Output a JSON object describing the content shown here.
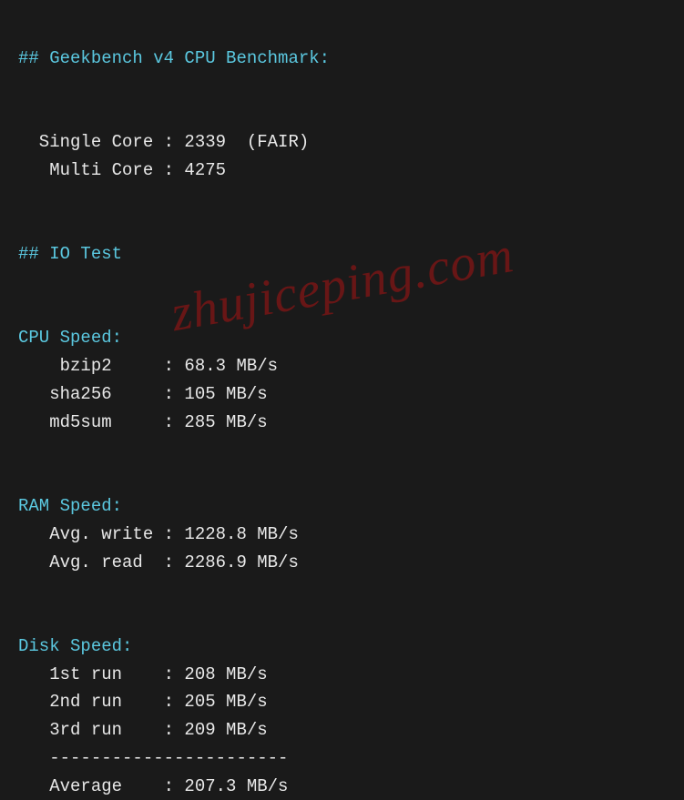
{
  "section1": {
    "heading": "## Geekbench v4 CPU Benchmark:",
    "lines": [
      "  Single Core : 2339  (FAIR)",
      "   Multi Core : 4275"
    ]
  },
  "section2": {
    "heading": "## IO Test"
  },
  "cpuSpeed": {
    "heading": "CPU Speed:",
    "lines": [
      "    bzip2     : 68.3 MB/s",
      "   sha256     : 105 MB/s",
      "   md5sum     : 285 MB/s"
    ]
  },
  "ramSpeed": {
    "heading": "RAM Speed:",
    "lines": [
      "   Avg. write : 1228.8 MB/s",
      "   Avg. read  : 2286.9 MB/s"
    ]
  },
  "diskSpeed": {
    "heading": "Disk Speed:",
    "lines": [
      "   1st run    : 208 MB/s",
      "   2nd run    : 205 MB/s",
      "   3rd run    : 209 MB/s",
      "   -----------------------",
      "   Average    : 207.3 MB/s"
    ]
  },
  "watermark": "zhujiceping.com"
}
